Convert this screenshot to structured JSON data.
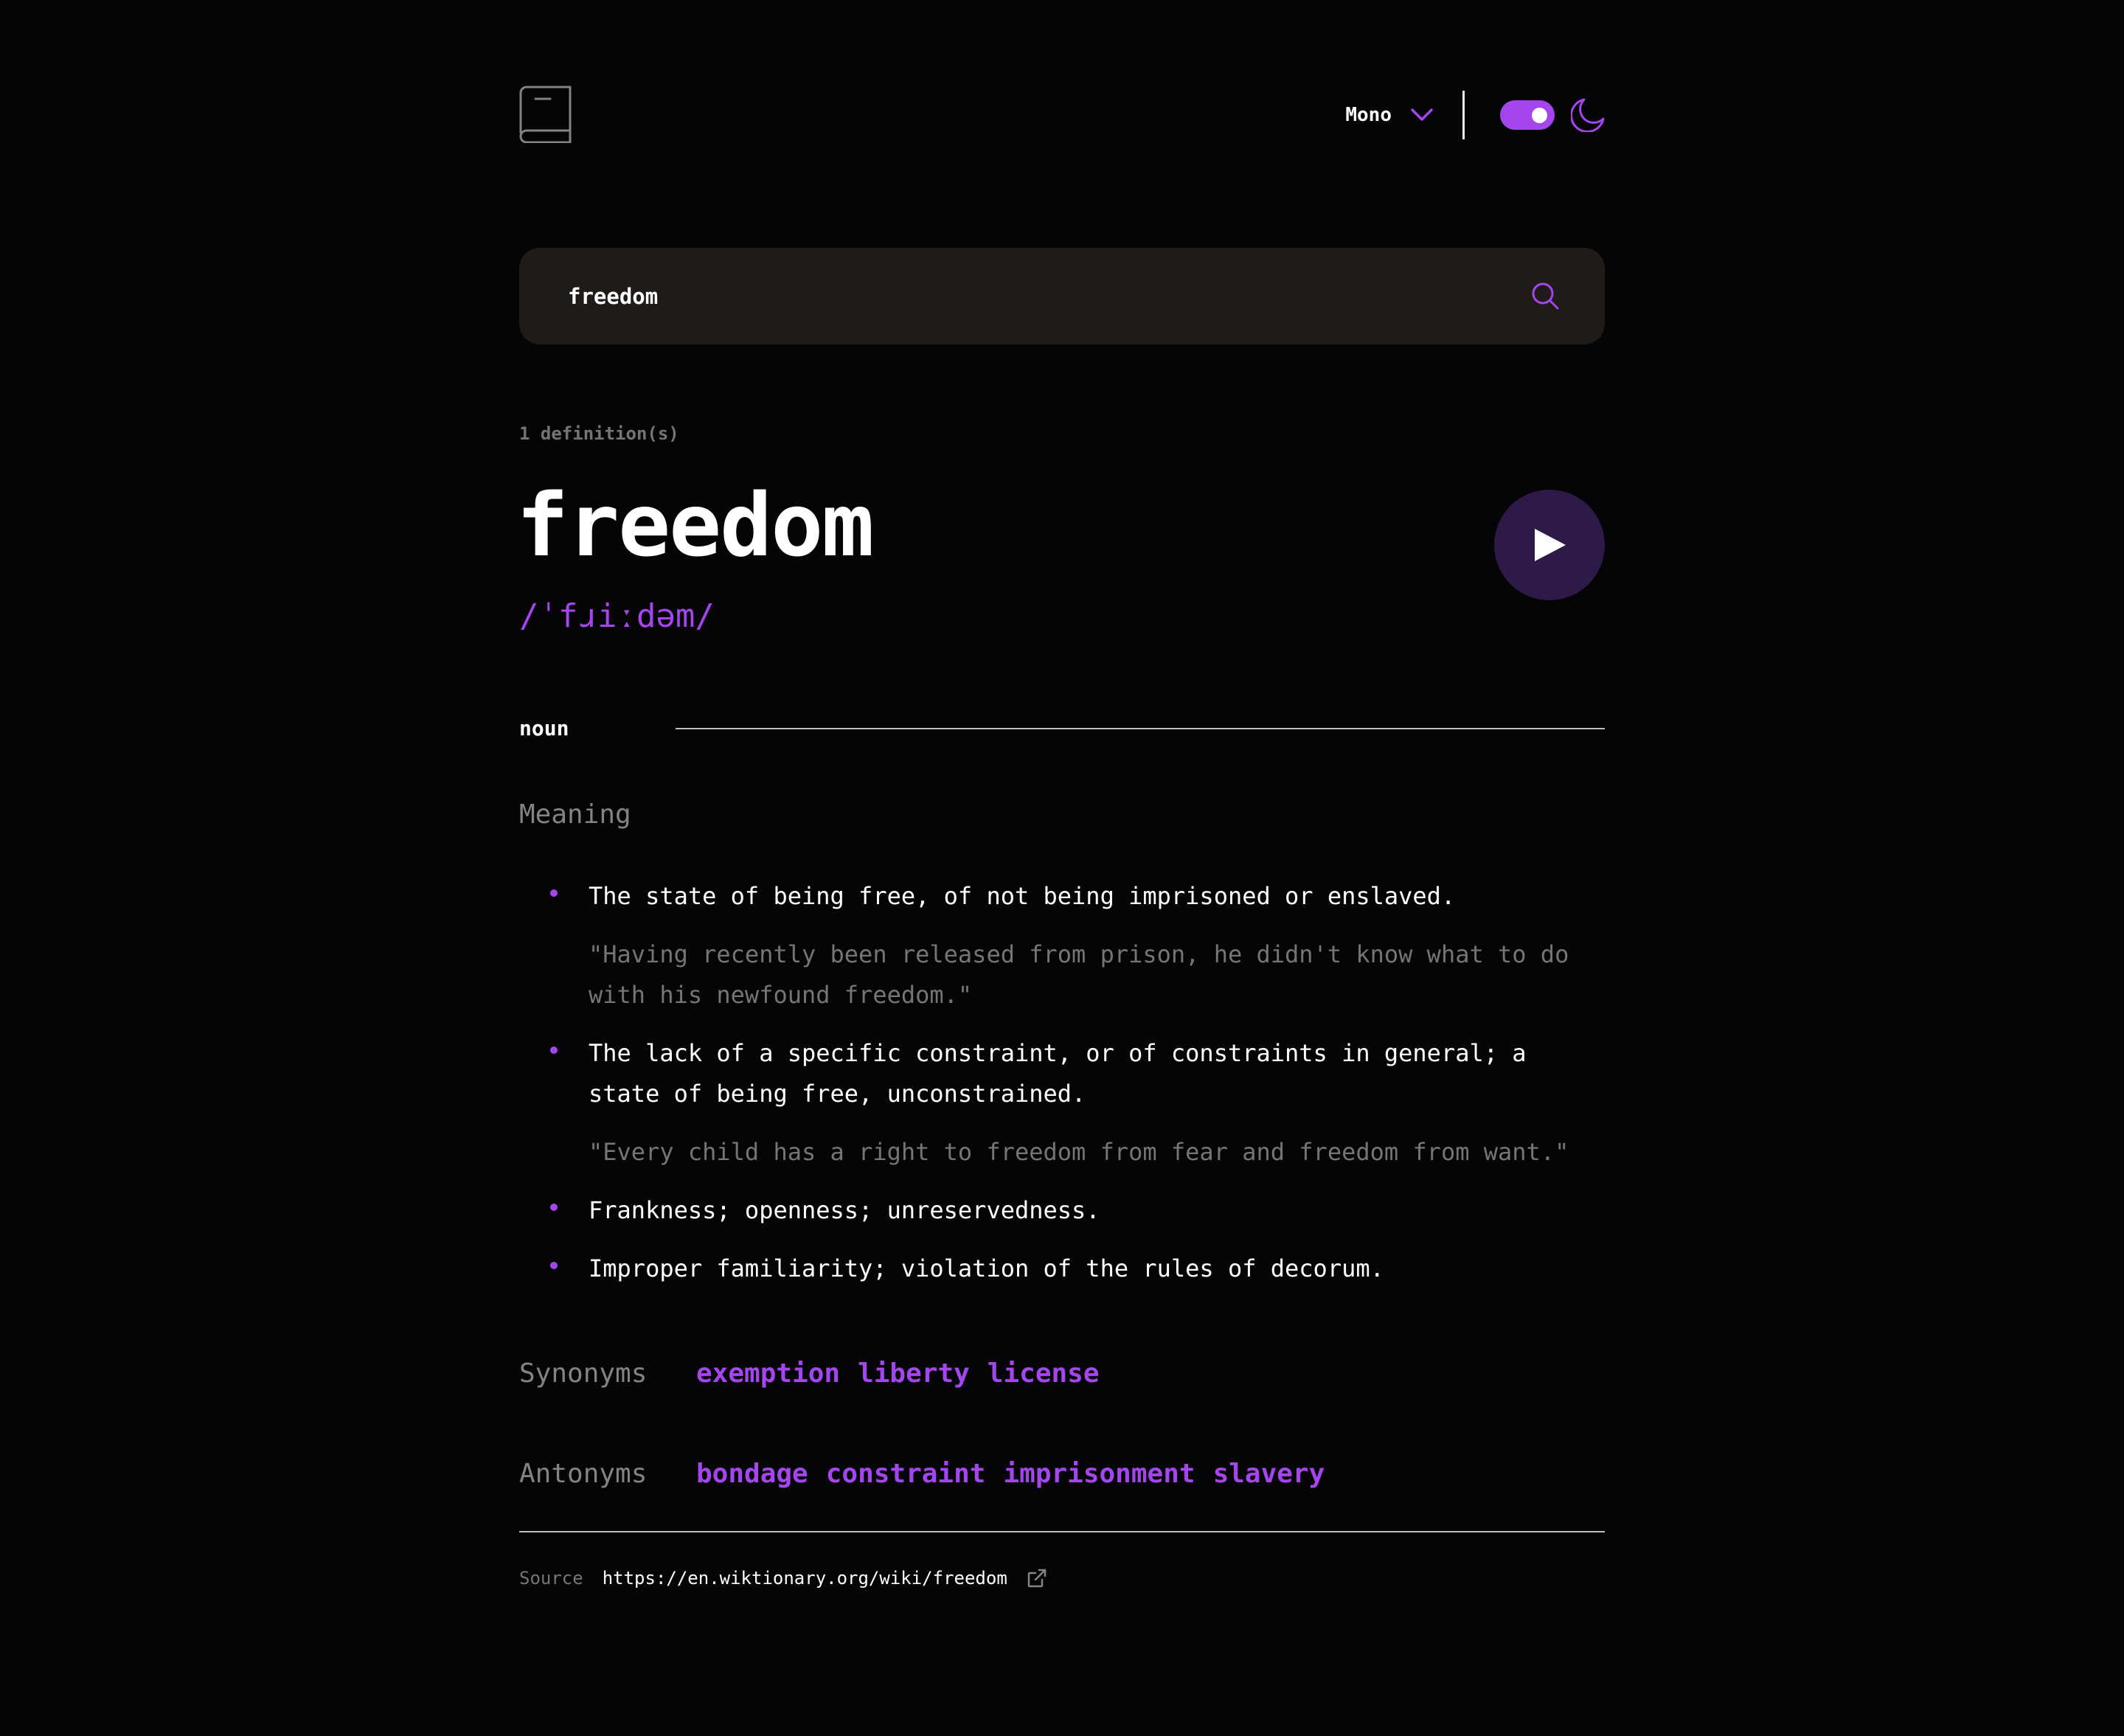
{
  "header": {
    "logo": "book-icon",
    "font_select": {
      "selected": "Mono",
      "icon": "chevron-down-icon"
    },
    "theme_toggle": {
      "state": "on",
      "icon": "moon-icon"
    }
  },
  "search": {
    "value": "freedom",
    "icon": "search-icon"
  },
  "result": {
    "definition_count": "1 definition(s)",
    "word": "freedom",
    "phonetic": "/ˈfɹiːdəm/",
    "play_icon": "play-icon",
    "part_of_speech": "noun",
    "meaning_heading": "Meaning",
    "definitions": [
      {
        "text": "The state of being free, of not being imprisoned or enslaved.",
        "example": "\"Having recently been released from prison, he didn't know what to do with his newfound freedom.\""
      },
      {
        "text": "The lack of a specific constraint, or of constraints in general; a state of being free, unconstrained.",
        "example": "\"Every child has a right to freedom from fear and freedom from want.\""
      },
      {
        "text": "Frankness; openness; unreservedness."
      },
      {
        "text": "Improper familiarity; violation of the rules of decorum."
      }
    ],
    "synonyms_label": "Synonyms",
    "synonyms": [
      "exemption",
      "liberty",
      "license"
    ],
    "antonyms_label": "Antonyms",
    "antonyms": [
      "bondage",
      "constraint",
      "imprisonment",
      "slavery"
    ]
  },
  "footer": {
    "source_label": "Source",
    "source_url": "https://en.wiktionary.org/wiki/freedom",
    "icon": "external-link-icon"
  },
  "colors": {
    "accent": "#a445ed",
    "background": "#050507",
    "search_bg": "#1e1b19",
    "muted_text": "#757575",
    "play_button_bg": "#2d1a48"
  }
}
